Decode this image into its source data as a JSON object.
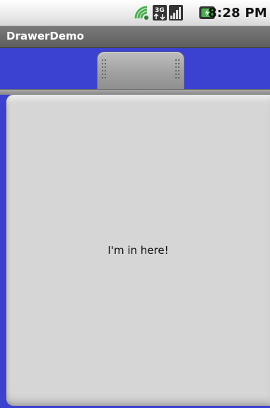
{
  "status_bar": {
    "time": "8:28 PM",
    "icons": [
      "wifi-icon",
      "3g-network-icon",
      "signal-strength-icon",
      "battery-icon"
    ]
  },
  "title_bar": {
    "title": "DrawerDemo"
  },
  "drawer": {
    "handle_icon": "drawer-handle-grip-icon",
    "content_text": "I'm in here!"
  },
  "colors": {
    "background": "#3b41d0",
    "drawer_content": "#d6d6d6",
    "title_bar": "#6a6a6a"
  }
}
